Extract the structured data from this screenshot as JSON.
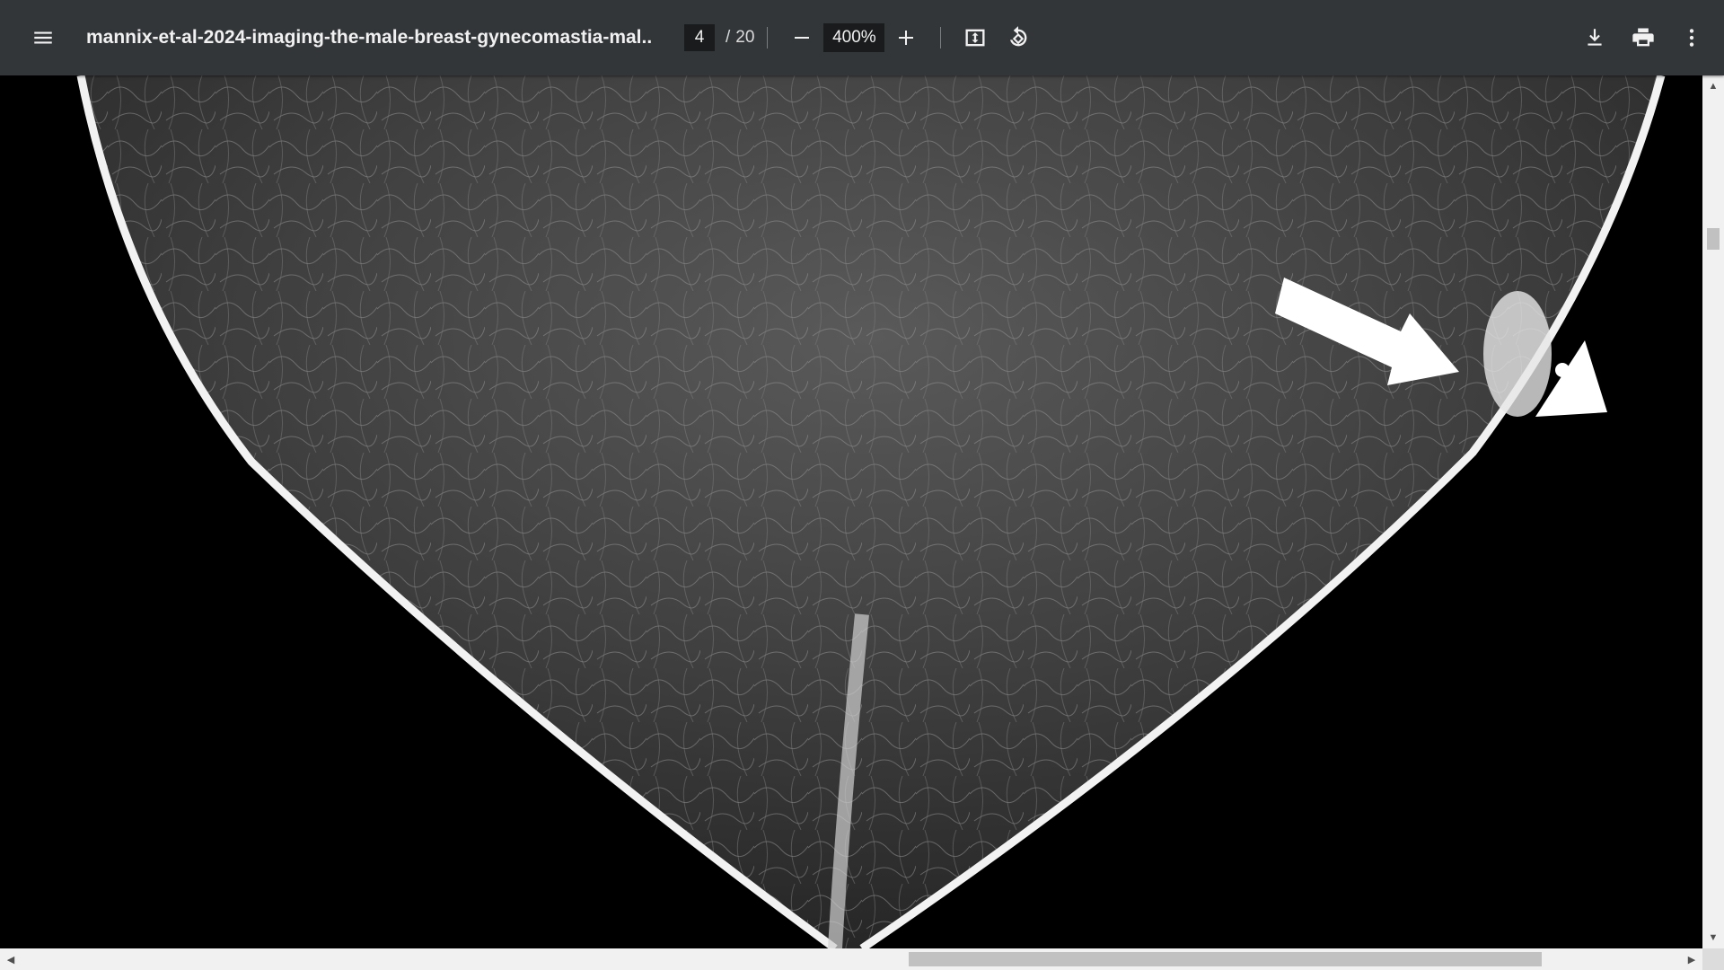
{
  "toolbar": {
    "title": "mannix-et-al-2024-imaging-the-male-breast-gynecomastia-mal...",
    "page_current": "4",
    "page_separator": "/",
    "page_total": "20",
    "zoom": "400%"
  },
  "icons": {
    "menu": "menu-icon",
    "zoom_out": "minus-icon",
    "zoom_in": "plus-icon",
    "fit": "fit-to-page-icon",
    "rotate": "rotate-icon",
    "download": "download-icon",
    "print": "print-icon",
    "more": "more-vert-icon"
  },
  "colors": {
    "toolbar_bg": "#323639",
    "viewer_bg": "#000000",
    "scrollbar_bg": "#f1f1f1"
  }
}
